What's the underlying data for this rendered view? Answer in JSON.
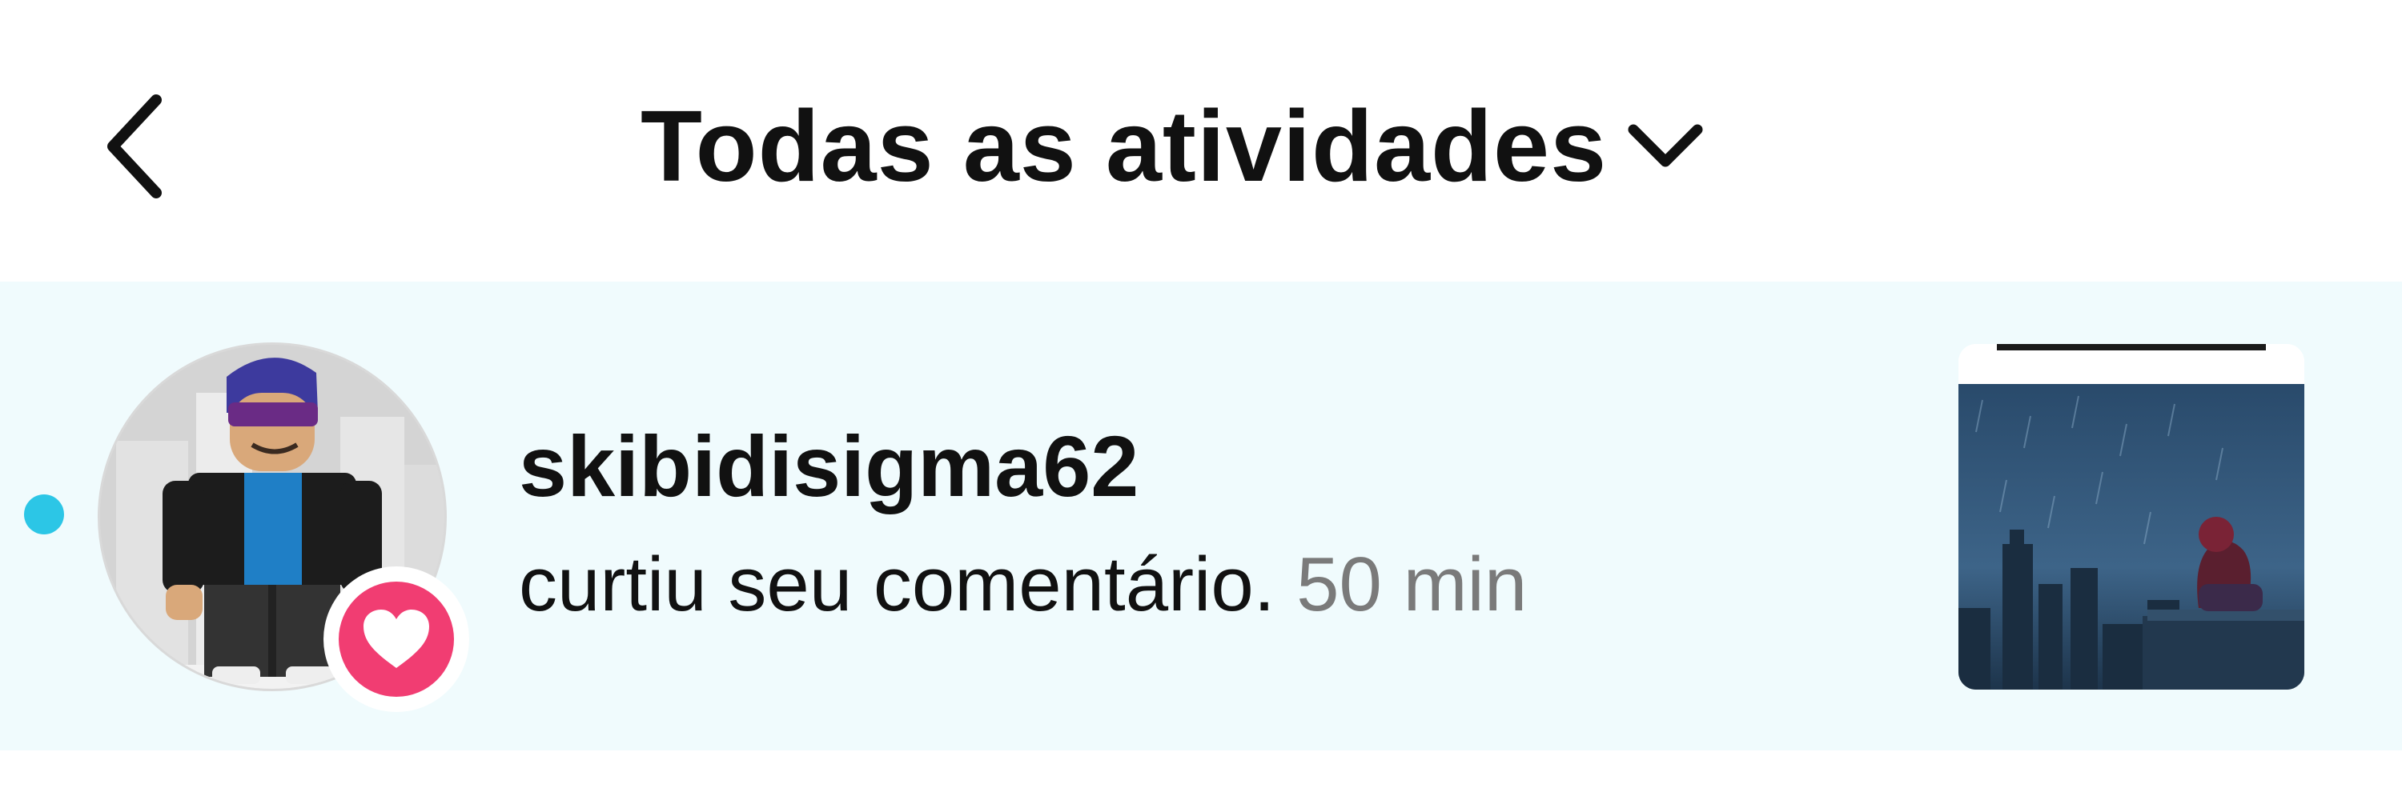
{
  "header": {
    "back_icon": "chevron-left-icon",
    "title": "Todas as atividades",
    "dropdown_icon": "chevron-down-icon"
  },
  "notification": {
    "unread": true,
    "username": "skibidisigma62",
    "action": "curtiu seu comentário.",
    "time": "50 min",
    "badge_icon": "heart-icon",
    "colors": {
      "row_background": "#f0fbfd",
      "unread_dot": "#2cc6e6",
      "like_badge": "#f13d72",
      "time_text": "#7a7a7a"
    }
  }
}
